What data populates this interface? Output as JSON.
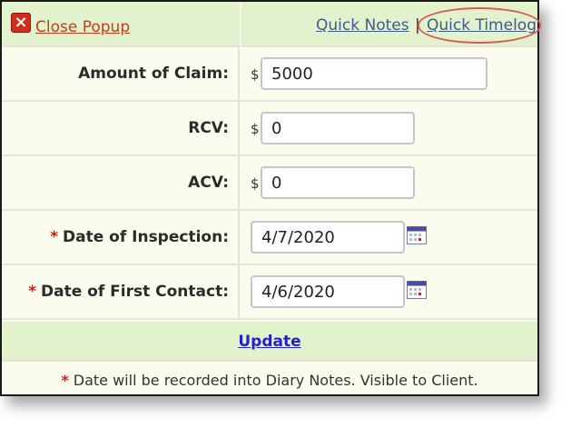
{
  "header": {
    "close_label": "Close Popup",
    "quick_notes_label": "Quick Notes",
    "separator": "|",
    "quick_timelog_label": "Quick Timelog"
  },
  "fields": {
    "amount_of_claim": {
      "label": "Amount of Claim:",
      "currency": "$",
      "value": "5000"
    },
    "rcv": {
      "label": "RCV:",
      "currency": "$",
      "value": "0"
    },
    "acv": {
      "label": "ACV:",
      "currency": "$",
      "value": "0"
    },
    "date_of_inspection": {
      "required_mark": "*",
      "label": "Date of Inspection:",
      "value": "4/7/2020",
      "icon": "calendar-icon"
    },
    "date_of_first_contact": {
      "required_mark": "*",
      "label": "Date of First Contact:",
      "value": "4/6/2020",
      "icon": "calendar-icon"
    }
  },
  "update_label": "Update",
  "footnote": {
    "mark": "*",
    "text": "Date will be recorded into Diary Notes. Visible to Client."
  },
  "colors": {
    "header_bg": "#e2f2cc",
    "body_bg": "#fcfcee",
    "link": "#3f5a8c",
    "close_link": "#c83a1c",
    "required": "#d81818",
    "highlight_ring": "#d95a55",
    "update_link": "#2222cc"
  }
}
